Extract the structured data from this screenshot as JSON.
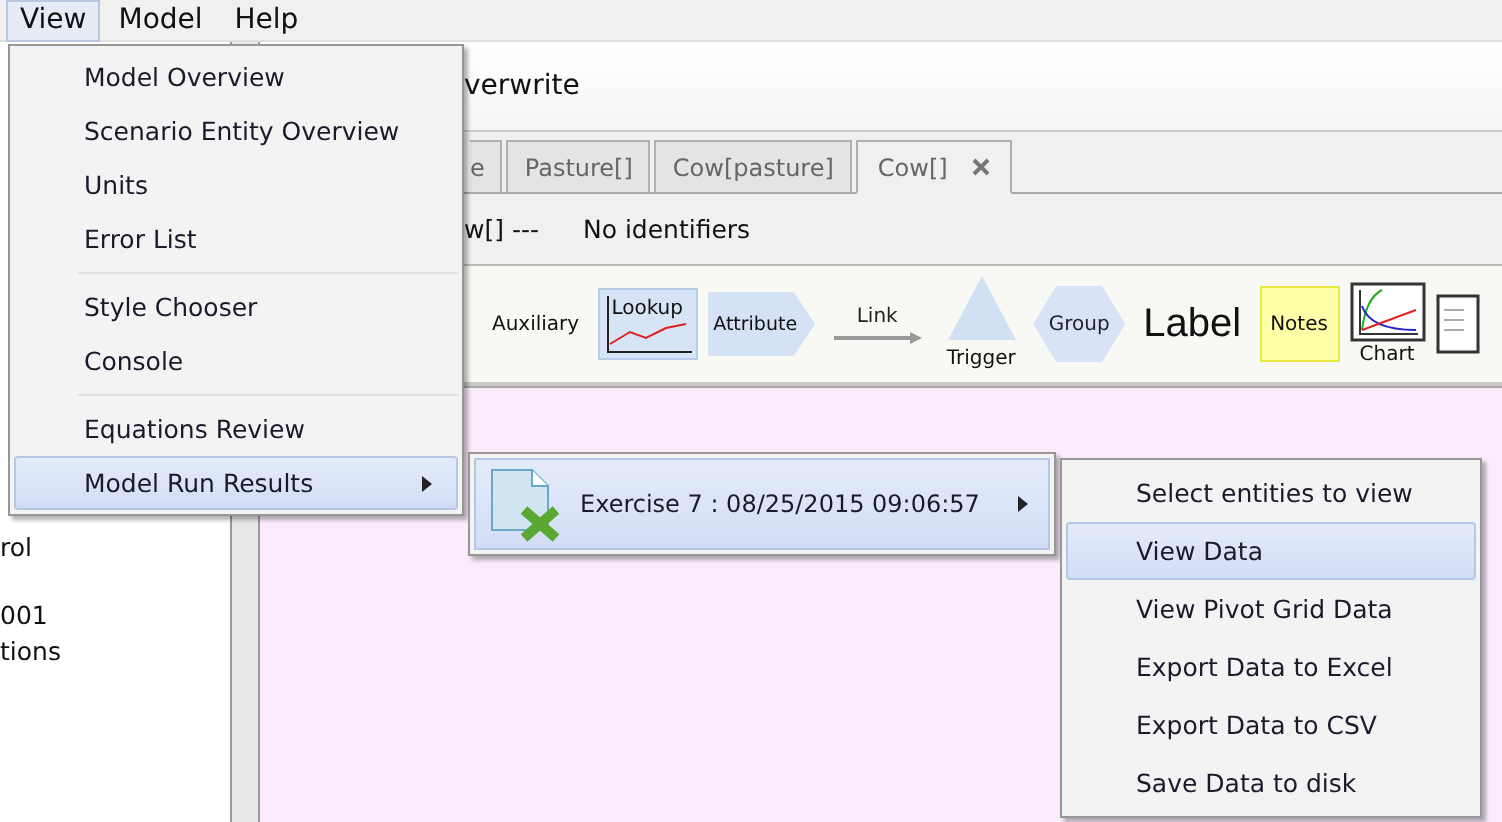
{
  "menubar": [
    {
      "label": "View",
      "selected": true
    },
    {
      "label": "Model",
      "selected": false
    },
    {
      "label": "Help",
      "selected": false
    }
  ],
  "left_panel": {
    "lines": [
      "rol",
      "001",
      "tions"
    ]
  },
  "document": {
    "title": "verwrite",
    "tabs": [
      {
        "label": "e",
        "selected": false
      },
      {
        "label": "Pasture[]",
        "selected": false
      },
      {
        "label": "Cow[pasture]",
        "selected": false
      },
      {
        "label": "Cow[]",
        "selected": true,
        "closable": true
      }
    ],
    "path": "w[] ---",
    "identifiers": "No identifiers",
    "tools": [
      {
        "kind": "auxiliary",
        "label": "Auxiliary",
        "selected": false
      },
      {
        "kind": "lookup",
        "label": "Lookup",
        "selected": true
      },
      {
        "kind": "attribute",
        "label": "Attribute",
        "selected": false
      },
      {
        "kind": "link",
        "label": "Link",
        "selected": false
      },
      {
        "kind": "trigger",
        "label": "Trigger",
        "selected": false
      },
      {
        "kind": "group",
        "label": "Group",
        "selected": false
      },
      {
        "kind": "label",
        "label": "Label",
        "selected": false
      },
      {
        "kind": "notes",
        "label": "Notes",
        "selected": false
      },
      {
        "kind": "chart",
        "label": "Chart",
        "selected": false
      },
      {
        "kind": "table",
        "selected": false
      }
    ]
  },
  "view_menu": {
    "groups": [
      [
        {
          "label": "Model Overview",
          "selected": false,
          "has_submenu": false
        },
        {
          "label": "Scenario Entity Overview",
          "selected": false,
          "has_submenu": false
        },
        {
          "label": "Units",
          "selected": false,
          "has_submenu": false
        },
        {
          "label": "Error List",
          "selected": false,
          "has_submenu": false
        }
      ],
      [
        {
          "label": "Style Chooser",
          "selected": false,
          "has_submenu": false
        },
        {
          "label": "Console",
          "selected": false,
          "has_submenu": false
        }
      ],
      [
        {
          "label": "Equations Review",
          "selected": false,
          "has_submenu": false
        },
        {
          "label": "Model Run Results",
          "selected": true,
          "has_submenu": true
        }
      ]
    ]
  },
  "results_menu": {
    "items": [
      {
        "label": "Exercise 7 : 08/25/2015 09:06:57",
        "selected": true,
        "has_submenu": true
      }
    ]
  },
  "data_menu": {
    "items": [
      {
        "label": "Select entities to view",
        "selected": false
      },
      {
        "label": "View Data",
        "selected": true
      },
      {
        "label": "View Pivot Grid Data",
        "selected": false
      },
      {
        "label": "Export Data to Excel",
        "selected": false
      },
      {
        "label": "Export Data to CSV",
        "selected": false
      },
      {
        "label": "Save Data to disk",
        "selected": false
      }
    ]
  }
}
